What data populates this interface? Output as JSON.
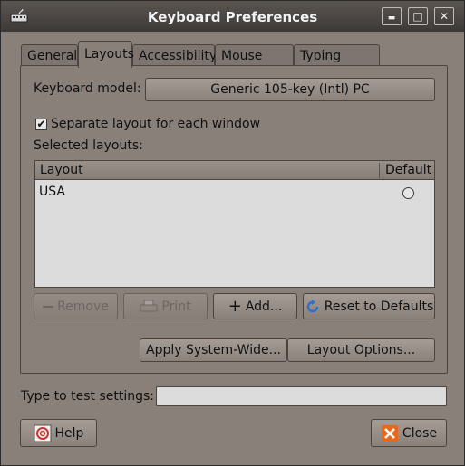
{
  "window": {
    "title": "Keyboard Preferences",
    "minimize_glyph": "▬",
    "maximize_glyph": "□",
    "close_glyph": "✕"
  },
  "tabs": [
    {
      "label": "General"
    },
    {
      "label": "Layouts"
    },
    {
      "label": "Accessibility"
    },
    {
      "label": "Mouse Keys"
    },
    {
      "label": "Typing Break"
    }
  ],
  "active_tab": "Layouts",
  "layouts_tab": {
    "keyboard_model_label": "Keyboard model:",
    "keyboard_model_value": "Generic 105-key (Intl) PC",
    "separate_layout_label": "Separate layout for each window",
    "separate_layout_checked": true,
    "check_glyph": "✔",
    "selected_layouts_label": "Selected layouts:",
    "columns": [
      "Layout",
      "Default"
    ],
    "rows": [
      {
        "layout": "USA",
        "default": false
      }
    ],
    "buttons": {
      "remove": "Remove",
      "print": "Print",
      "add": "Add...",
      "reset": "Reset to Defaults",
      "apply_system_wide": "Apply System-Wide...",
      "layout_options": "Layout Options..."
    }
  },
  "test_settings": {
    "label": "Type to test settings:",
    "value": ""
  },
  "footer": {
    "help": "Help",
    "close": "Close"
  },
  "colors": {
    "window_bg": "#8a807a",
    "titlebar": "#3d3936",
    "list_bg": "#dcdcdc",
    "close_icon": "#e8681a",
    "reset_icon": "#2a6fd0"
  }
}
